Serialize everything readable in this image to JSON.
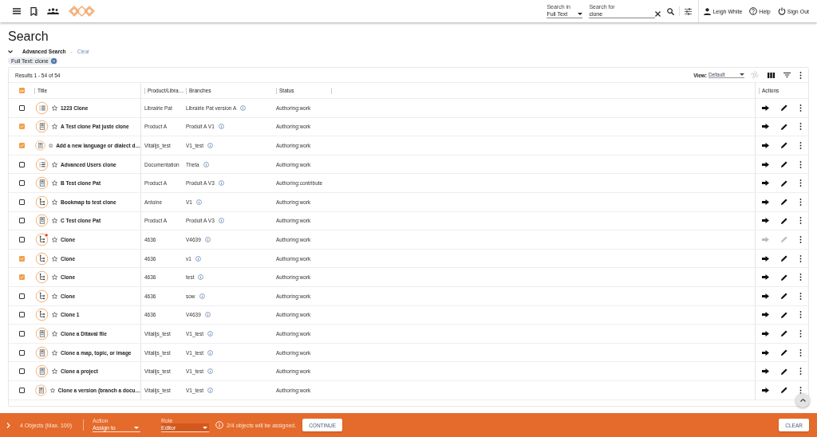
{
  "header": {
    "search_in": {
      "label": "Search in",
      "value": "Full Text"
    },
    "search_for": {
      "label": "Search for",
      "value": "clone"
    },
    "user": "Leigh White",
    "help": "Help",
    "sign_out": "Sign Out"
  },
  "page_title": "Search",
  "advanced_search": {
    "label": "Advanced Search",
    "separator": "-",
    "clear": "Clear",
    "expanded": true
  },
  "filters": [
    {
      "label": "Full Text: clone"
    }
  ],
  "results": {
    "summary": "Results 1 - 54 of 54",
    "view_label": "View:",
    "view_value": "Default"
  },
  "table": {
    "select_all": {
      "indeterminate": true
    },
    "columns": [
      "Title",
      "Product/Libra…",
      "Branches",
      "Status",
      "Actions"
    ],
    "rows": [
      {
        "kind": "list",
        "title": "1223 Clone",
        "product": "Librairie Pat",
        "branch": "Librairie Pat version A",
        "status": "Authoring:work",
        "checked": false,
        "starred": false,
        "alert": false,
        "disabled": false
      },
      {
        "kind": "topic",
        "title": "A Test clone Pat juste clone",
        "product": "Product A",
        "branch": "Produit A V1",
        "status": "Authoring:work",
        "checked": true,
        "starred": false,
        "alert": false,
        "disabled": false
      },
      {
        "kind": "topic",
        "title": "Add a new language or dialect d…",
        "product": "Vitalijs_test",
        "branch": "V1_test",
        "status": "Authoring:work",
        "checked": true,
        "starred": false,
        "alert": false,
        "disabled": false
      },
      {
        "kind": "list",
        "title": "Advanced Users clone",
        "product": "Documentation",
        "branch": "Theta",
        "status": "Authoring:work",
        "checked": false,
        "starred": false,
        "alert": false,
        "disabled": false
      },
      {
        "kind": "topic",
        "title": "B Test clone Pat",
        "product": "Product A",
        "branch": "Produit A V3",
        "status": "Authoring:contribute",
        "checked": false,
        "starred": false,
        "alert": false,
        "disabled": false
      },
      {
        "kind": "map",
        "title": "Bookmap to test clone",
        "product": "Antoine",
        "branch": "V1",
        "status": "Authoring:work",
        "checked": false,
        "starred": false,
        "alert": false,
        "disabled": false
      },
      {
        "kind": "topic",
        "title": "C Test clone Pat",
        "product": "Product A",
        "branch": "Produit A V3",
        "status": "Authoring:work",
        "checked": false,
        "starred": false,
        "alert": false,
        "disabled": false
      },
      {
        "kind": "map",
        "title": "Clone",
        "product": "4636",
        "branch": "V4639",
        "status": "Authoring:work",
        "checked": false,
        "starred": false,
        "alert": true,
        "disabled": true
      },
      {
        "kind": "map",
        "title": "Clone",
        "product": "4636",
        "branch": "v1",
        "status": "Authoring:work",
        "checked": true,
        "starred": false,
        "alert": false,
        "disabled": false
      },
      {
        "kind": "map",
        "title": "Clone",
        "product": "4636",
        "branch": "test",
        "status": "Authoring:work",
        "checked": true,
        "starred": false,
        "alert": false,
        "disabled": false
      },
      {
        "kind": "map",
        "title": "Clone",
        "product": "4636",
        "branch": "sow",
        "status": "Authoring:work",
        "checked": false,
        "starred": false,
        "alert": false,
        "disabled": false
      },
      {
        "kind": "map",
        "title": "Clone 1",
        "product": "4636",
        "branch": "V4639",
        "status": "Authoring:work",
        "checked": false,
        "starred": false,
        "alert": false,
        "disabled": false
      },
      {
        "kind": "topic",
        "title": "Clone a Ditaval file",
        "product": "Vitalijs_test",
        "branch": "V1_test",
        "status": "Authoring:work",
        "checked": false,
        "starred": false,
        "alert": false,
        "disabled": false
      },
      {
        "kind": "topic",
        "title": "Clone a map, topic, or image",
        "product": "Vitalijs_test",
        "branch": "V1_test",
        "status": "Authoring:work",
        "checked": false,
        "starred": false,
        "alert": false,
        "disabled": false
      },
      {
        "kind": "topic",
        "title": "Clone a project",
        "product": "Vitalijs_test",
        "branch": "V1_test",
        "status": "Authoring:work",
        "checked": false,
        "starred": false,
        "alert": false,
        "disabled": false
      },
      {
        "kind": "topic",
        "title": "Clone a version (branch a docu…",
        "product": "Vitalijs_test",
        "branch": "V1_test",
        "status": "Authoring:work",
        "checked": false,
        "starred": false,
        "alert": false,
        "disabled": false
      }
    ]
  },
  "action_bar": {
    "expanded": false,
    "count": "4 Objects (Max. 100)",
    "action": {
      "label": "Action",
      "value": "Assign to"
    },
    "role": {
      "label": "Role",
      "value": "Editor"
    },
    "message": "2/4 objects will be assigned.",
    "continue": "CONTINUE",
    "clear": "CLEAR"
  }
}
